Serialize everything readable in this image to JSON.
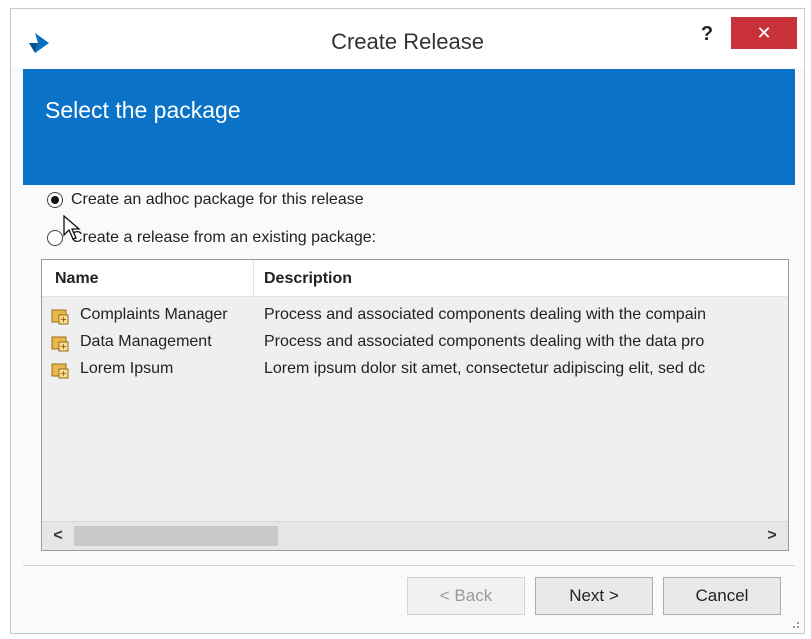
{
  "window": {
    "title": "Create Release",
    "help_label": "?",
    "close_label": "✕"
  },
  "banner": {
    "title": "Select the package",
    "color": "#0a73c8"
  },
  "options": {
    "adhoc_label": "Create an adhoc package for this release",
    "existing_label": "Create a release from an existing package:",
    "selected": "adhoc"
  },
  "packages": {
    "columns": [
      "Name",
      "Description"
    ],
    "rows": [
      {
        "name": "Complaints Manager",
        "description": "Process and associated components dealing with the compain",
        "icon": "package-icon"
      },
      {
        "name": "Data Management",
        "description": "Process and associated components dealing with the data pro",
        "icon": "package-icon"
      },
      {
        "name": "Lorem Ipsum",
        "description": "Lorem ipsum dolor sit amet, consectetur adipiscing elit, sed dc",
        "icon": "package-icon"
      }
    ],
    "scroll_left": "<",
    "scroll_right": ">"
  },
  "buttons": {
    "back_label": "< Back",
    "next_label": "Next >",
    "cancel_label": "Cancel"
  },
  "colors": {
    "close_button": "#c8303a",
    "accent": "#0a73c8"
  }
}
